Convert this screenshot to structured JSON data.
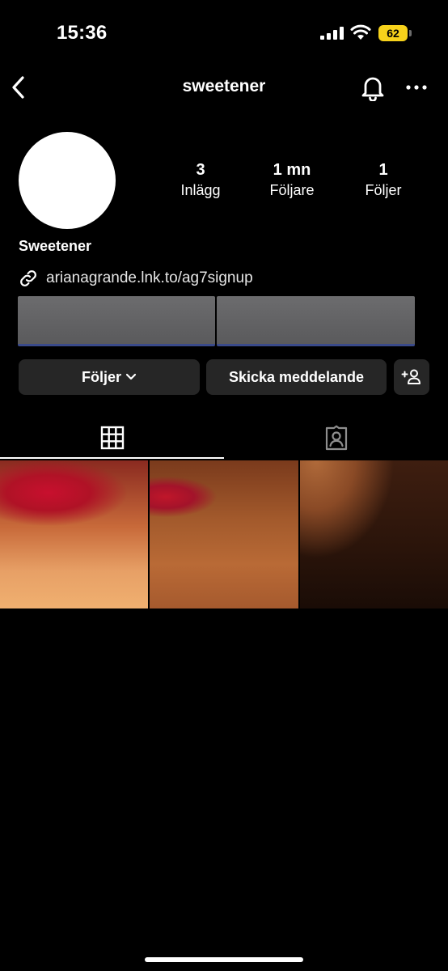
{
  "status_bar": {
    "time": "15:36",
    "battery_level": "62",
    "battery_color": "#f7d21b"
  },
  "header": {
    "username": "sweetener",
    "icons": [
      "chevron-left-icon",
      "bell-icon",
      "more-horizontal-icon"
    ]
  },
  "profile": {
    "display_name": "Sweetener",
    "link": "arianagrande.lnk.to/ag7signup",
    "stats": [
      {
        "value": "3",
        "label": "Inlägg"
      },
      {
        "value": "1 mn",
        "label": "Följare"
      },
      {
        "value": "1",
        "label": "Följer"
      }
    ]
  },
  "actions": {
    "follow_label": "Följer",
    "message_label": "Skicka meddelande"
  },
  "tabs": {
    "icons": [
      "grid-icon",
      "tagged-person-icon"
    ],
    "active": "grid"
  },
  "colors": {
    "background": "#000000",
    "button_bg": "#262626",
    "text": "#ffffff"
  }
}
